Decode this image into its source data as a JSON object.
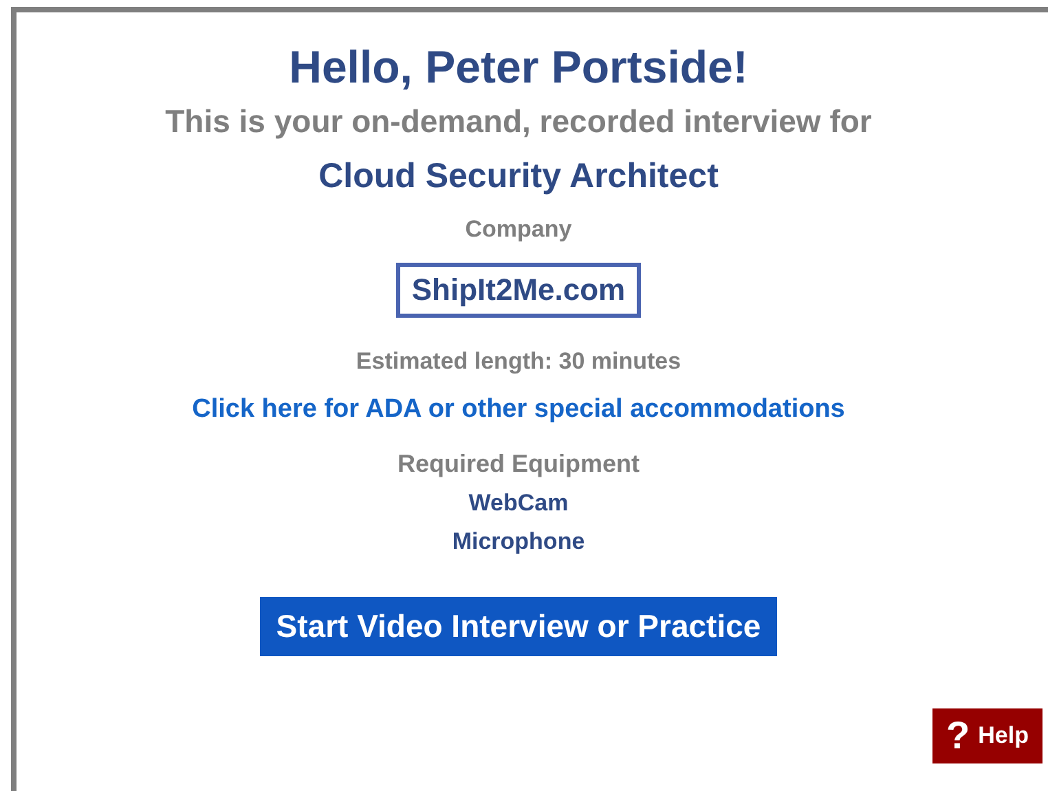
{
  "greeting": "Hello, Peter Portside!",
  "intro": "This is your on-demand, recorded interview for",
  "job_title": "Cloud Security Architect",
  "company_label": "Company",
  "company": "ShipIt2Me.com",
  "length": "Estimated length: 30 minutes",
  "accommodations_link": "Click here for ADA or other special accommodations",
  "equipment_label": "Required Equipment",
  "equipment": [
    "WebCam",
    "Microphone"
  ],
  "start_button": "Start Video Interview or Practice",
  "help_button": {
    "icon": "?",
    "label": "Help"
  }
}
